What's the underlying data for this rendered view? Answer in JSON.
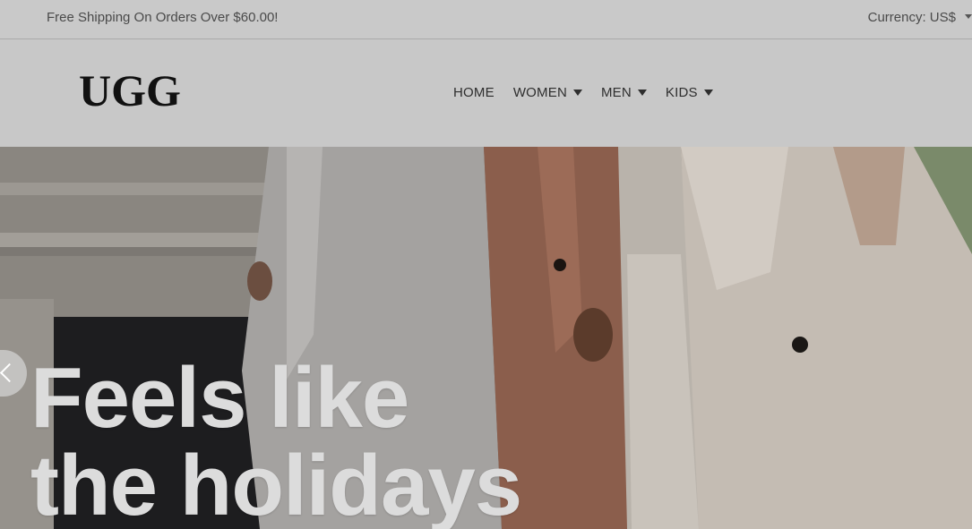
{
  "topbar": {
    "shipping_text": "Free Shipping On Orders Over $60.00!",
    "currency_label": "Currency: US$"
  },
  "brand": {
    "logo_text": "UGG"
  },
  "nav": {
    "items": [
      {
        "label": "HOME",
        "has_dropdown": false
      },
      {
        "label": "WOMEN",
        "has_dropdown": true
      },
      {
        "label": "MEN",
        "has_dropdown": true
      },
      {
        "label": "KIDS",
        "has_dropdown": true
      }
    ]
  },
  "hero": {
    "headline_line1": "Feels like",
    "headline_line2": "the holidays",
    "prev_icon": "chevron-left-icon"
  },
  "colors": {
    "overlay": "#c8c8c8",
    "nav_text": "#2e2e2e",
    "headline": "#dcdcdc"
  }
}
